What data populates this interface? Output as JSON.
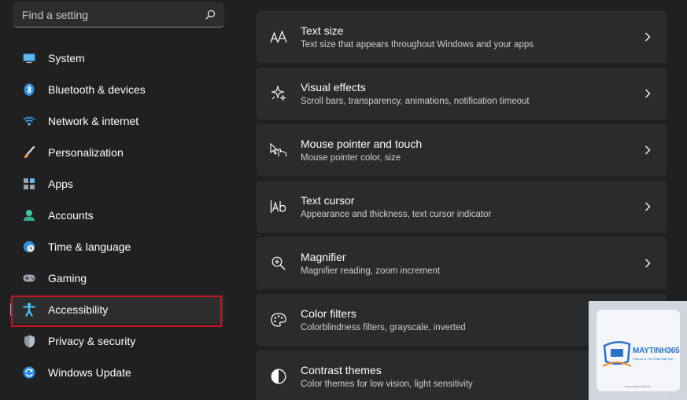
{
  "search": {
    "placeholder": "Find a setting"
  },
  "sidebar": {
    "items": [
      {
        "label": "System",
        "icon": "monitor-icon"
      },
      {
        "label": "Bluetooth & devices",
        "icon": "bluetooth-icon"
      },
      {
        "label": "Network & internet",
        "icon": "wifi-icon"
      },
      {
        "label": "Personalization",
        "icon": "paintbrush-icon"
      },
      {
        "label": "Apps",
        "icon": "apps-icon"
      },
      {
        "label": "Accounts",
        "icon": "person-icon"
      },
      {
        "label": "Time & language",
        "icon": "globe-clock-icon"
      },
      {
        "label": "Gaming",
        "icon": "gamepad-icon"
      },
      {
        "label": "Accessibility",
        "icon": "accessibility-icon",
        "active": true
      },
      {
        "label": "Privacy & security",
        "icon": "shield-icon"
      },
      {
        "label": "Windows Update",
        "icon": "update-icon"
      }
    ]
  },
  "main": {
    "cards": [
      {
        "title": "Text size",
        "subtitle": "Text size that appears throughout Windows and your apps",
        "icon": "text-size-icon"
      },
      {
        "title": "Visual effects",
        "subtitle": "Scroll bars, transparency, animations, notification timeout",
        "icon": "sparkle-icon"
      },
      {
        "title": "Mouse pointer and touch",
        "subtitle": "Mouse pointer color, size",
        "icon": "pointer-touch-icon"
      },
      {
        "title": "Text cursor",
        "subtitle": "Appearance and thickness, text cursor indicator",
        "icon": "text-cursor-icon"
      },
      {
        "title": "Magnifier",
        "subtitle": "Magnifier reading, zoom increment",
        "icon": "magnifier-icon"
      },
      {
        "title": "Color filters",
        "subtitle": "Colorblindness filters, grayscale, inverted",
        "icon": "palette-icon"
      },
      {
        "title": "Contrast themes",
        "subtitle": "Color themes for low vision, light sensitivity",
        "icon": "contrast-icon"
      }
    ]
  },
  "watermark": {
    "brand": "MAYTINH365",
    "tagline": "Chia sẻ & Thủ thuật Máy tính",
    "url": "www.maytinh365.net"
  },
  "colors": {
    "accent": "#4cc2ff",
    "highlight_border": "#c4161c",
    "background": "#202020",
    "card": "#2b2b2b"
  }
}
